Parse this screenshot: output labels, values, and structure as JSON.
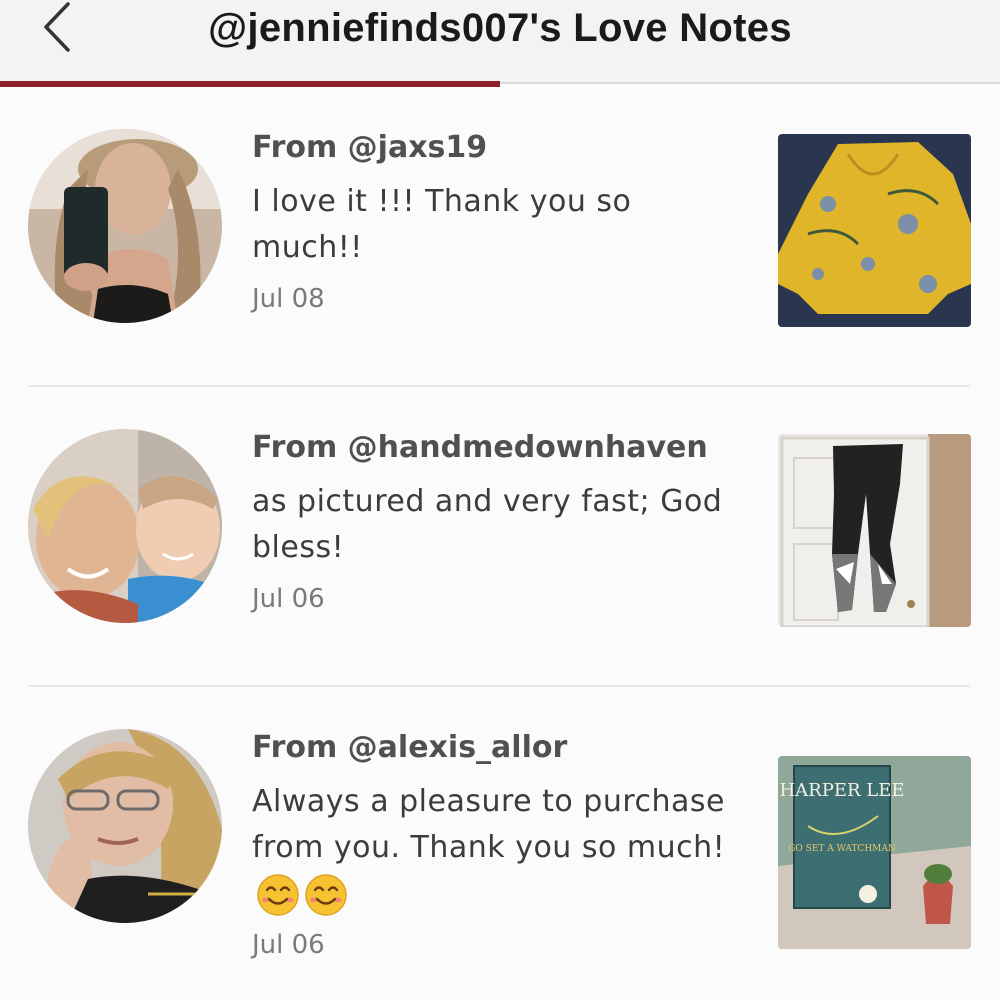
{
  "header": {
    "title": "@jenniefinds007's Love Notes",
    "back_icon": "chevron-left-icon",
    "accent_color": "#8c1f2a",
    "progress": 0.5
  },
  "notes": [
    {
      "from": "From @jaxs19",
      "message": "I love it !!! Thank you so much!!",
      "date": "Jul 08",
      "emojis": []
    },
    {
      "from": "From @handmedownhaven",
      "message": "as pictured and very fast; God bless!",
      "date": "Jul 06",
      "emojis": []
    },
    {
      "from": "From @alexis_allor",
      "message": "Always a pleasure to purchase from you. Thank you so much!",
      "date": "Jul 06",
      "emojis": [
        "smiling-face-icon",
        "smiling-face-icon"
      ]
    }
  ],
  "book_cover": {
    "author": "HARPER LEE",
    "title": "GO SET A WATCHMAN"
  }
}
